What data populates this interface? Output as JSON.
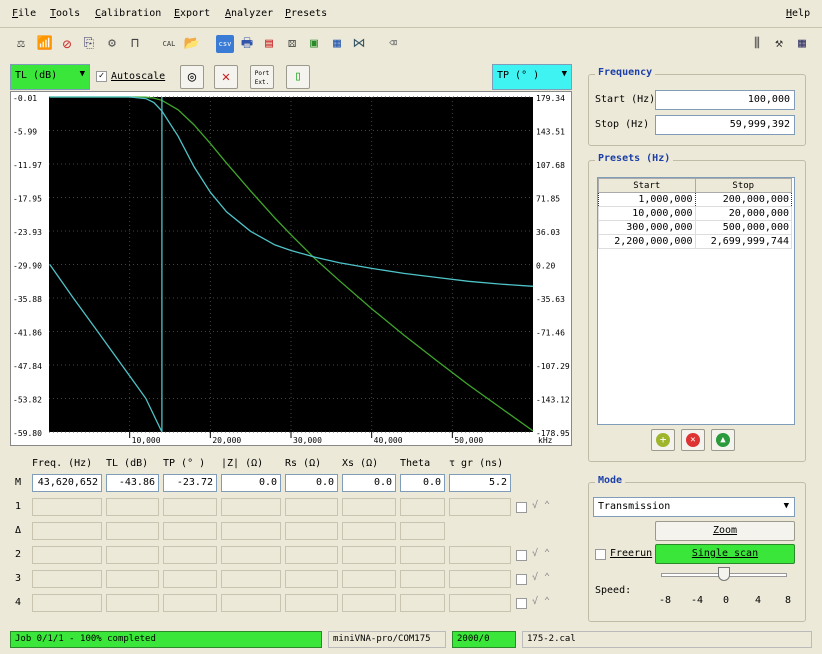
{
  "menu": [
    "File",
    "Tools",
    "Calibration",
    "Export",
    "Analyzer",
    "Presets"
  ],
  "menu_help": "Help",
  "toolbar_icons": [
    "scale-icon",
    "signal-icon",
    "clock-icon",
    "export-icon",
    "settings-icon",
    "graph-icon",
    "cal-icon",
    "open-icon",
    "csv-icon",
    "printer-icon",
    "pdf-icon",
    "dice-icon",
    "image-icon",
    "zplot-icon",
    "network-icon",
    "eraser-icon"
  ],
  "toolbar_right_icons": [
    "bars-icon",
    "tools-icon",
    "calculator-icon"
  ],
  "toolbar_cal_label": "CAL",
  "toolbar_csv_label": "csv",
  "chart_header": {
    "left_select": "TL (dB)",
    "autoscale_label": "Autoscale",
    "port_ext_label": "Port\nExt.",
    "right_select": "TP (° )"
  },
  "colors": {
    "green": "#39e639",
    "cyan": "#3ff3f3",
    "trace_green": "#3fa62b",
    "trace_cyan": "#4fc3c8",
    "title_blue": "#1c3fa8"
  },
  "chart_data": {
    "type": "line",
    "x_unit": "kHz",
    "x_ticks": [
      "10,000",
      "20,000",
      "30,000",
      "40,000",
      "50,000"
    ],
    "y_left_ticks": [
      "-0.01",
      "-5.99",
      "-11.97",
      "-17.95",
      "-23.93",
      "-29.90",
      "-35.88",
      "-41.86",
      "-47.84",
      "-53.82",
      "-59.80"
    ],
    "y_right_ticks": [
      "179.34",
      "143.51",
      "107.68",
      "71.85",
      "36.03",
      "0.20",
      "-35.63",
      "-71.46",
      "-107.29",
      "-143.12",
      "-178.95"
    ],
    "x_range": [
      0,
      59999.392
    ],
    "ylim_left": [
      -59.8,
      -0.01
    ],
    "ylim_right": [
      -178.95,
      179.34
    ],
    "grid": true,
    "series": [
      {
        "axis": "left",
        "x": [
          100,
          5000,
          10000,
          12000,
          13000,
          14000,
          16000,
          18000,
          20000,
          22000,
          25000,
          28000,
          30000,
          33000,
          36000,
          40000,
          44000,
          48000,
          52000,
          56000,
          59999
        ],
        "y": [
          -0.01,
          -0.01,
          -0.01,
          -0.05,
          -0.2,
          -0.6,
          -2.3,
          -5.0,
          -8.3,
          -11.8,
          -16.8,
          -21.6,
          -24.6,
          -28.9,
          -32.8,
          -37.8,
          -42.5,
          -47.0,
          -51.4,
          -55.5,
          -59.6
        ]
      },
      {
        "axis": "left",
        "x": [
          100,
          5000,
          10000,
          12000,
          13000,
          14000,
          16000,
          18000,
          20000,
          22000,
          25000,
          28000,
          30000,
          33000,
          36000,
          40000,
          44000,
          48000,
          52000,
          56000,
          59999
        ],
        "y": [
          -0.01,
          -0.01,
          -0.01,
          -0.3,
          -1.0,
          -2.5,
          -7.0,
          -12.5,
          -17.0,
          -20.5,
          -24.0,
          -26.4,
          -27.4,
          -28.6,
          -29.6,
          -30.6,
          -31.5,
          -32.2,
          -32.9,
          -33.4,
          -33.8
        ]
      },
      {
        "axis": "right",
        "x": [
          100,
          3000,
          6000,
          9000,
          12000,
          13999,
          14000,
          14001
        ],
        "y": [
          0.2,
          -35.5,
          -71.0,
          -107.0,
          -143.0,
          -178.95,
          179.34,
          -178.95
        ]
      }
    ]
  },
  "frequency": {
    "title": "Frequency",
    "start_label": "Start (Hz)",
    "start_value": "100,000",
    "stop_label": "Stop (Hz)",
    "stop_value": "59,999,392"
  },
  "presets": {
    "title": "Presets (Hz)",
    "headers": [
      "Start",
      "Stop"
    ],
    "rows": [
      [
        "1,000,000",
        "200,000,000"
      ],
      [
        "10,000,000",
        "20,000,000"
      ],
      [
        "300,000,000",
        "500,000,000"
      ],
      [
        "2,200,000,000",
        "2,699,999,744"
      ]
    ]
  },
  "marker_table": {
    "headers": [
      "Freq. (Hz)",
      "TL (dB)",
      "TP (° )",
      "|Z| (Ω)",
      "Rs (Ω)",
      "Xs (Ω)",
      "Theta",
      "τ gr (ns)"
    ],
    "row_labels": [
      "M",
      "1",
      "Δ",
      "2",
      "3",
      "4"
    ],
    "m_row": [
      "43,620,652",
      "-43.86",
      "-23.72",
      "0.0",
      "0.0",
      "0.0",
      "0.0",
      "5.2"
    ]
  },
  "mode": {
    "title": "Mode",
    "select": "Transmission",
    "zoom_label": "Zoom",
    "freerun_label": "Freerun",
    "single_scan_label": "Single scan",
    "speed_label": "Speed:",
    "speed_ticks": [
      "-8",
      "-4",
      "0",
      "4",
      "8"
    ],
    "speed_value": 0
  },
  "status": {
    "job": "Job 0/1/1 - 100% completed",
    "device": "miniVNA-pro/COM175",
    "count": "2000/0",
    "cal_file": "175-2.cal"
  }
}
